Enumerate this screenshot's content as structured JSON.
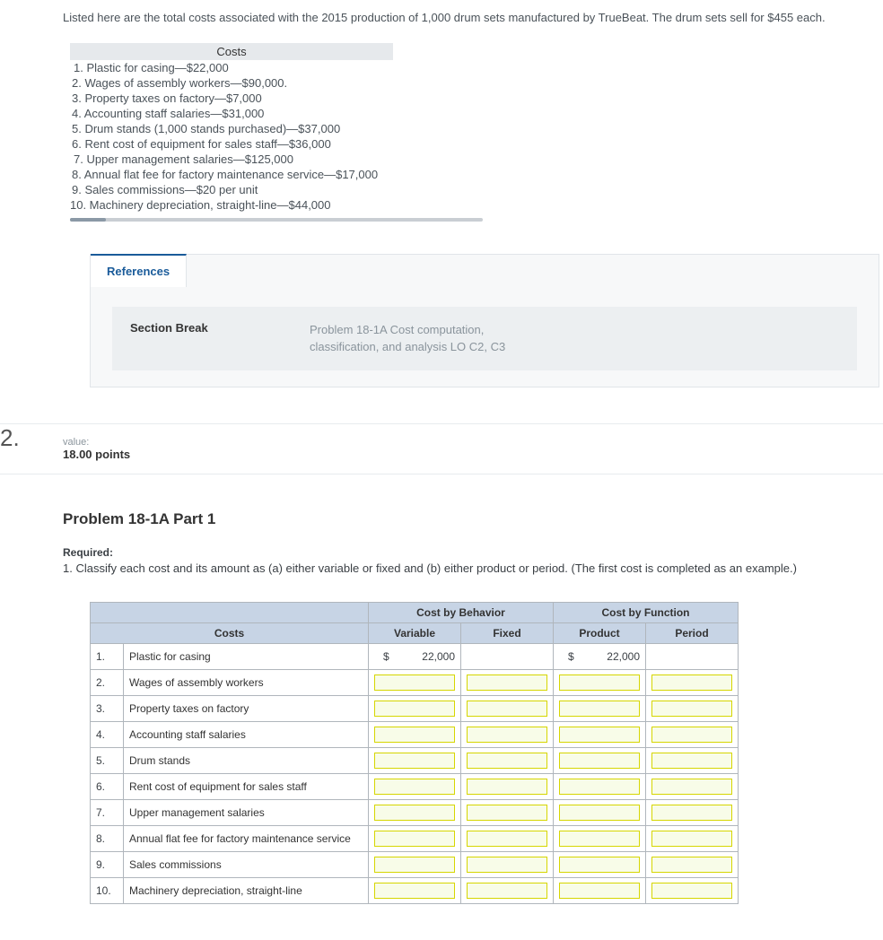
{
  "intro": "Listed here are the total costs associated with the 2015 production of 1,000 drum sets manufactured by TrueBeat. The drum sets sell for $455 each.",
  "costs_header": "Costs",
  "cost_items": [
    "1. Plastic for casing—$22,000",
    "2. Wages of assembly workers—$90,000.",
    "3. Property taxes on factory—$7,000",
    "4. Accounting staff salaries—$31,000",
    "5. Drum stands (1,000 stands purchased)—$37,000",
    "6. Rent cost of equipment for sales staff—$36,000",
    "7. Upper management salaries—$125,000",
    "8. Annual flat fee for factory maintenance service—$17,000",
    "9. Sales commissions—$20 per unit",
    "10. Machinery depreciation, straight-line—$44,000"
  ],
  "references": {
    "tab": "References",
    "section": "Section Break",
    "desc_line1": "Problem 18-1A Cost computation,",
    "desc_line2": "classification, and analysis LO C2, C3"
  },
  "question": {
    "num": "2.",
    "value_label": "value:",
    "points": "18.00 points"
  },
  "problem": {
    "title": "Problem 18-1A Part 1",
    "required_label": "Required:",
    "required_text": "1.  Classify each cost and its amount as (a) either variable or fixed and (b) either product or period. (The first cost is completed as an example.)"
  },
  "table": {
    "group1": "Cost by Behavior",
    "group2": "Cost by Function",
    "h_costs": "Costs",
    "h_var": "Variable",
    "h_fixed": "Fixed",
    "h_prod": "Product",
    "h_period": "Period",
    "rows": [
      {
        "n": "1.",
        "name": "Plastic for casing",
        "var": "22,000",
        "prod": "22,000"
      },
      {
        "n": "2.",
        "name": "Wages of assembly workers"
      },
      {
        "n": "3.",
        "name": "Property taxes on factory"
      },
      {
        "n": "4.",
        "name": "Accounting staff salaries"
      },
      {
        "n": "5.",
        "name": "Drum stands"
      },
      {
        "n": "6.",
        "name": "Rent cost of equipment for sales staff"
      },
      {
        "n": "7.",
        "name": "Upper management salaries"
      },
      {
        "n": "8.",
        "name": "Annual flat fee for factory maintenance service"
      },
      {
        "n": "9.",
        "name": "Sales commissions"
      },
      {
        "n": "10.",
        "name": "Machinery depreciation, straight-line"
      }
    ]
  }
}
